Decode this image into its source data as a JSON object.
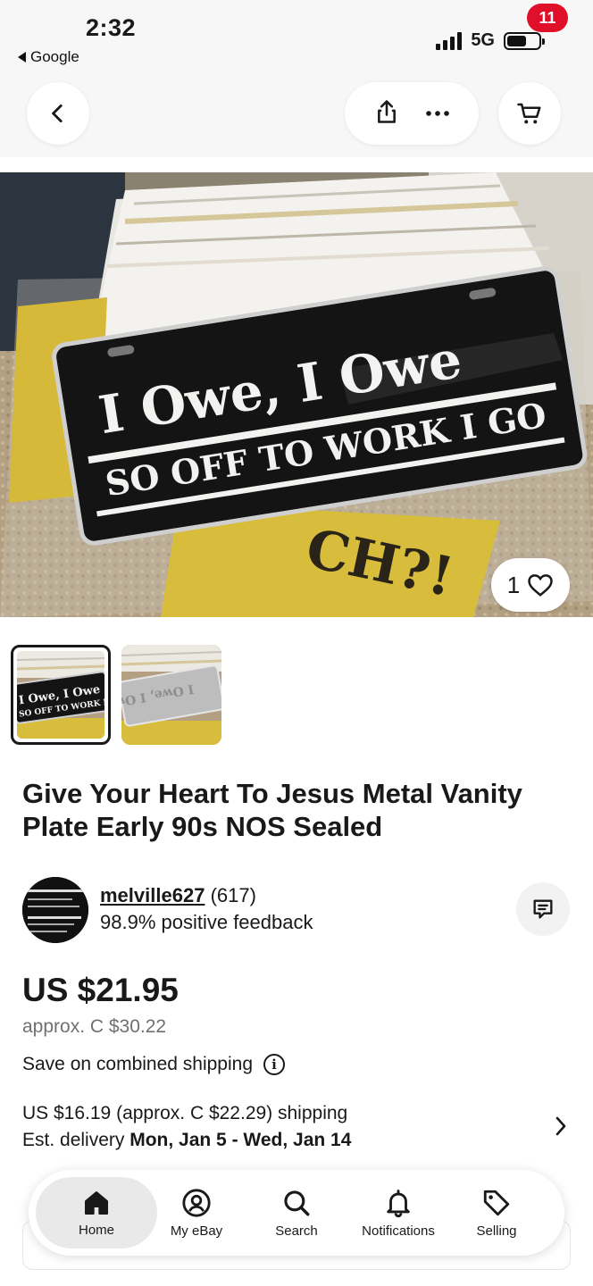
{
  "status_bar": {
    "time": "2:32",
    "back_app": "Google",
    "network": "5G"
  },
  "nav": {
    "cart_count": "11"
  },
  "gallery": {
    "plate_line1": "I Owe, I Owe",
    "plate_line2": "SO OFF TO WORK I GO",
    "watch_count": "1"
  },
  "listing": {
    "title": "Give Your Heart To Jesus Metal Vanity Plate Early 90s NOS Sealed",
    "seller_name": "melville627",
    "seller_score": "(617)",
    "seller_feedback": "98.9% positive feedback",
    "price": "US $21.95",
    "approx_price": "approx. C $30.22",
    "combined_shipping": "Save on combined shipping",
    "shipping": "US $16.19 (approx. C $22.29) shipping",
    "delivery_label": "Est. delivery",
    "delivery_dates": "Mon, Jan 5 - Wed, Jan 14"
  },
  "tabs": [
    {
      "label": "Home",
      "icon": "home-icon"
    },
    {
      "label": "My eBay",
      "icon": "user-icon"
    },
    {
      "label": "Search",
      "icon": "search-icon"
    },
    {
      "label": "Notifications",
      "icon": "bell-icon"
    },
    {
      "label": "Selling",
      "icon": "tag-icon"
    }
  ]
}
